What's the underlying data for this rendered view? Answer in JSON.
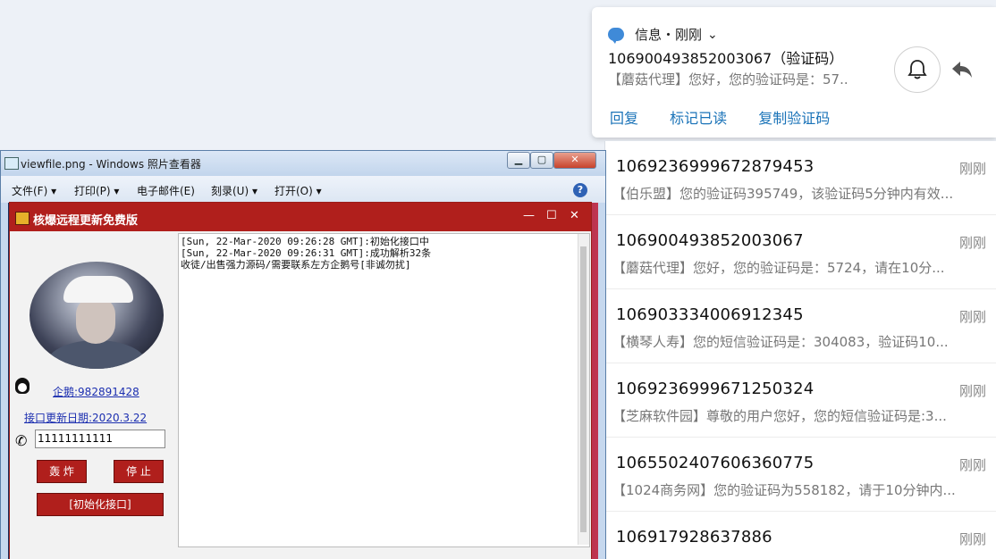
{
  "notification": {
    "app_label": "信息・刚刚",
    "sender": "106900493852003067（验证码）",
    "preview": "【蘑菇代理】您好，您的验证码是：57..",
    "actions": [
      "回复",
      "标记已读",
      "复制验证码"
    ]
  },
  "messages": [
    {
      "number": "1069236999672879453",
      "time": "刚刚",
      "body": "【伯乐盟】您的验证码395749，该验证码5分钟内有效..."
    },
    {
      "number": "106900493852003067",
      "time": "刚刚",
      "body": "【蘑菇代理】您好，您的验证码是：5724，请在10分..."
    },
    {
      "number": "106903334006912345",
      "time": "刚刚",
      "body": "【横琴人寿】您的短信验证码是：304083，验证码10..."
    },
    {
      "number": "1069236999671250324",
      "time": "刚刚",
      "body": "【芝麻软件园】尊敬的用户您好，您的短信验证码是:3..."
    },
    {
      "number": "1065502407606360775",
      "time": "刚刚",
      "body": "【1024商务网】您的验证码为558182，请于10分钟内..."
    },
    {
      "number": "106917928637886",
      "time": "刚刚",
      "body": ""
    }
  ],
  "viewer": {
    "title": "viewfile.png - Windows 照片查看器",
    "menu": [
      "文件(F)",
      "打印(P)",
      "电子邮件(E)",
      "刻录(U)",
      "打开(O)"
    ]
  },
  "app": {
    "title": "核爆远程更新免费版",
    "qq_label": "企鹅:982891428",
    "update_label": "接口更新日期:2020.3.22",
    "phone_value": "11111111111",
    "bomb_button": "轰 炸",
    "stop_button": "停 止",
    "init_button": "[初始化接口]",
    "log_lines": [
      "[Sun, 22-Mar-2020 09:26:28 GMT]:初始化接口中",
      "[Sun, 22-Mar-2020 09:26:31 GMT]:成功解析32条",
      "收徒/出售强力源码/需要联系左方企鹅号[非诚勿扰]"
    ]
  }
}
